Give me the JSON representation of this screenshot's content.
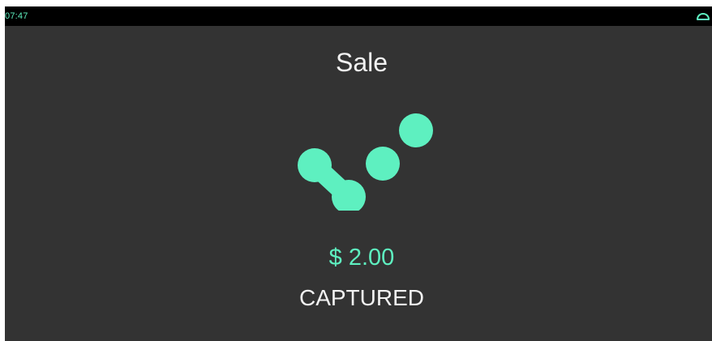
{
  "status_bar": {
    "time": "07:47",
    "icon": "cloud-icon",
    "accent_color": "#5ef0c0"
  },
  "transaction": {
    "type": "Sale",
    "amount": "$ 2.00",
    "status": "CAPTURED"
  },
  "logo": {
    "icon": "brand-dots-logo",
    "color": "#5ef0c0"
  },
  "colors": {
    "background": "#333333",
    "status_bar": "#000000",
    "accent": "#5ef0c0",
    "text": "#f2f2f2"
  }
}
